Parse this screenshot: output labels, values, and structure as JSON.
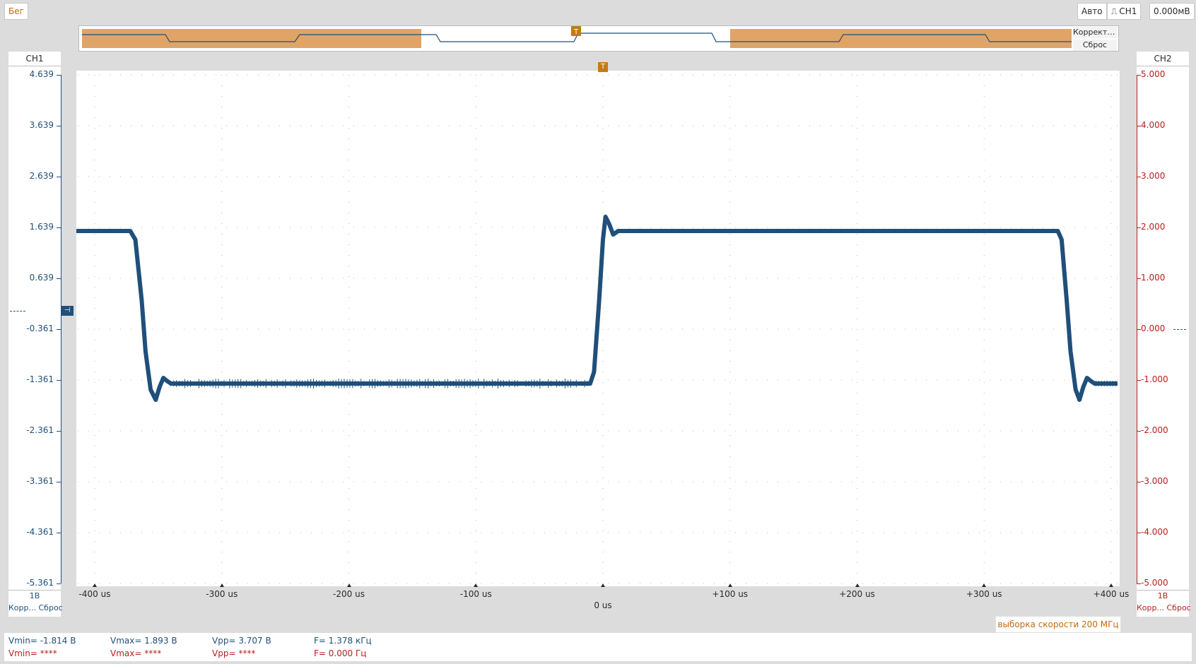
{
  "top": {
    "run_label": "Бег",
    "auto_label": "Авто",
    "trigger_source_label": "CH1",
    "trigger_level_label": "0.000мВ"
  },
  "overview": {
    "correct_label": "Корректи...",
    "reset_label": "Сброс",
    "trigger_marker": "T"
  },
  "ch1": {
    "title": "CH1",
    "scale": "1В",
    "bottom_label": "Корр... Сброс",
    "color": "#1f4f7a",
    "ticks": [
      "4.639",
      "3.639",
      "2.639",
      "1.639",
      "0.639",
      "-0.361",
      "-1.361",
      "-2.361",
      "-3.361",
      "-4.361",
      "-5.361"
    ]
  },
  "ch2": {
    "title": "CH2",
    "scale": "1В",
    "bottom_label": "Корр... Сброс",
    "color": "#b51e1e",
    "ticks": [
      "5.000",
      "4.000",
      "3.000",
      "2.000",
      "1.000",
      "0.000",
      "-1.000",
      "-2.000",
      "-3.000",
      "-4.000",
      "-5.000"
    ]
  },
  "time_axis": {
    "ticks": [
      "-400 us",
      "-300 us",
      "-200 us",
      "-100 us",
      "",
      "+100 us",
      "+200 us",
      "+300 us",
      "+400 us"
    ],
    "center_label": "0 us",
    "trigger_marker": "T"
  },
  "sample_rate": "выборка скорости 200 МГц",
  "measurements": {
    "ch1": [
      "Vmin= -1.814 В",
      "Vmax= 1.893 В",
      "Vpp= 3.707 В",
      "F= 1.378 кГц"
    ],
    "ch2": [
      "Vmin= ****",
      "Vmax= ****",
      "Vpp= ****",
      "F= 0.000 Гц"
    ]
  },
  "chart_data": {
    "type": "line",
    "x_unit": "us",
    "xlim": [
      -400,
      400
    ],
    "ylim_ch1": [
      -5.361,
      4.639
    ],
    "ylim_ch2": [
      -5,
      5
    ],
    "grid": true,
    "series": [
      {
        "name": "CH1",
        "x": [
          -415,
          -372,
          -368,
          -363,
          -360,
          -356,
          -352,
          -349,
          -346,
          -343,
          -340,
          -10,
          -7,
          -3,
          0,
          2,
          5,
          8,
          12,
          358,
          361,
          365,
          368,
          372,
          375,
          378,
          381,
          384,
          387,
          405
        ],
        "y": [
          1.57,
          1.57,
          1.4,
          0.2,
          -0.8,
          -1.55,
          -1.75,
          -1.5,
          -1.32,
          -1.38,
          -1.43,
          -1.43,
          -1.2,
          0.2,
          1.4,
          1.85,
          1.7,
          1.5,
          1.57,
          1.57,
          1.4,
          0.2,
          -0.8,
          -1.55,
          -1.75,
          -1.5,
          -1.32,
          -1.38,
          -1.43,
          -1.43
        ]
      }
    ]
  }
}
